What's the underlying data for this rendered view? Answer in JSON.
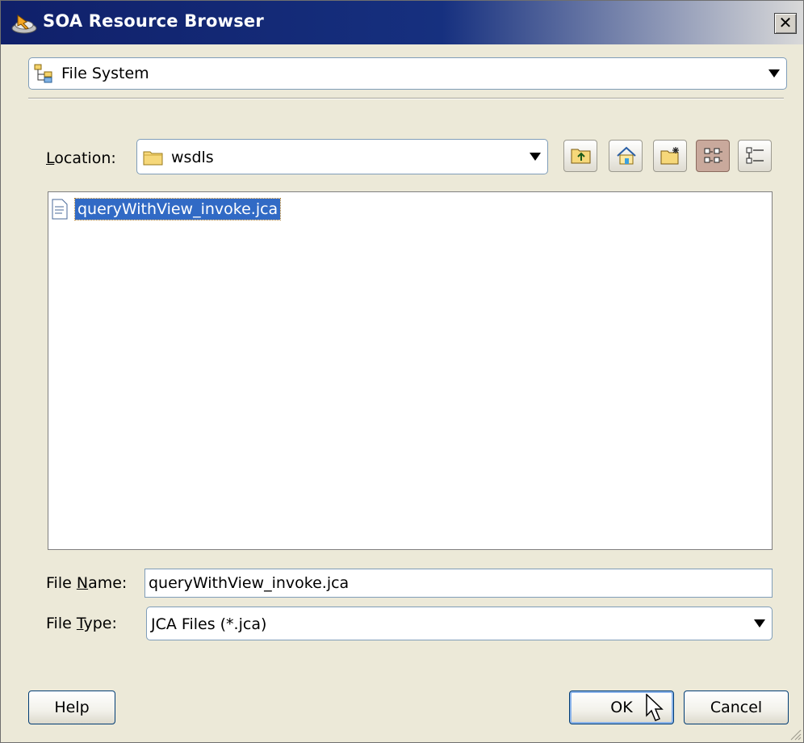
{
  "window": {
    "title": "SOA Resource Browser",
    "close_glyph": "✕"
  },
  "source": {
    "selected": "File System",
    "icon": "file-system-icon"
  },
  "location": {
    "label": "Location:",
    "underline_char": "L",
    "label_rest": "ocation:",
    "selected": "wsdls",
    "icon": "folder-icon"
  },
  "toolbar": {
    "up_icon": "up-folder-icon",
    "home_icon": "home-icon",
    "new_folder_icon": "new-folder-icon",
    "icon_view_icon": "icon-view-icon",
    "list_view_icon": "list-view-icon"
  },
  "files": [
    {
      "name": "queryWithView_invoke.jca",
      "selected": true,
      "icon": "document-icon"
    }
  ],
  "file_name": {
    "label_pre": "File ",
    "underline_char": "N",
    "label_post": "ame:",
    "value": "queryWithView_invoke.jca"
  },
  "file_type": {
    "label_pre": "File ",
    "underline_char": "T",
    "label_post": "ype:",
    "value": "JCA Files (*.jca)"
  },
  "buttons": {
    "help": "Help",
    "ok": "OK",
    "cancel": "Cancel"
  },
  "colors": {
    "titlebar": "#10206a",
    "selection": "#316ac5",
    "dialog_bg": "#ece9d8"
  }
}
